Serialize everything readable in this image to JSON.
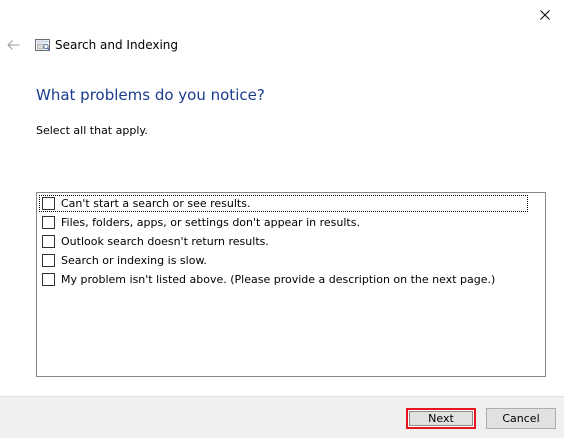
{
  "window": {
    "title": "Search and Indexing"
  },
  "main": {
    "heading": "What problems do you notice?",
    "instruction": "Select all that apply."
  },
  "problems": [
    {
      "label": "Can't start a search or see results.",
      "checked": false
    },
    {
      "label": "Files, folders, apps, or settings don't appear in results.",
      "checked": false
    },
    {
      "label": "Outlook search doesn't return results.",
      "checked": false
    },
    {
      "label": "Search or indexing is slow.",
      "checked": false
    },
    {
      "label": "My problem isn't listed above. (Please provide a description on the next page.)",
      "checked": false
    }
  ],
  "footer": {
    "next_label": "Next",
    "cancel_label": "Cancel"
  },
  "icons": {
    "close": "close-icon",
    "back": "back-arrow-icon",
    "app": "search-indexing-icon"
  },
  "colors": {
    "heading": "#1a3c8c",
    "footer_bg": "#f0f0f0",
    "next_highlight": "#e8141e"
  }
}
